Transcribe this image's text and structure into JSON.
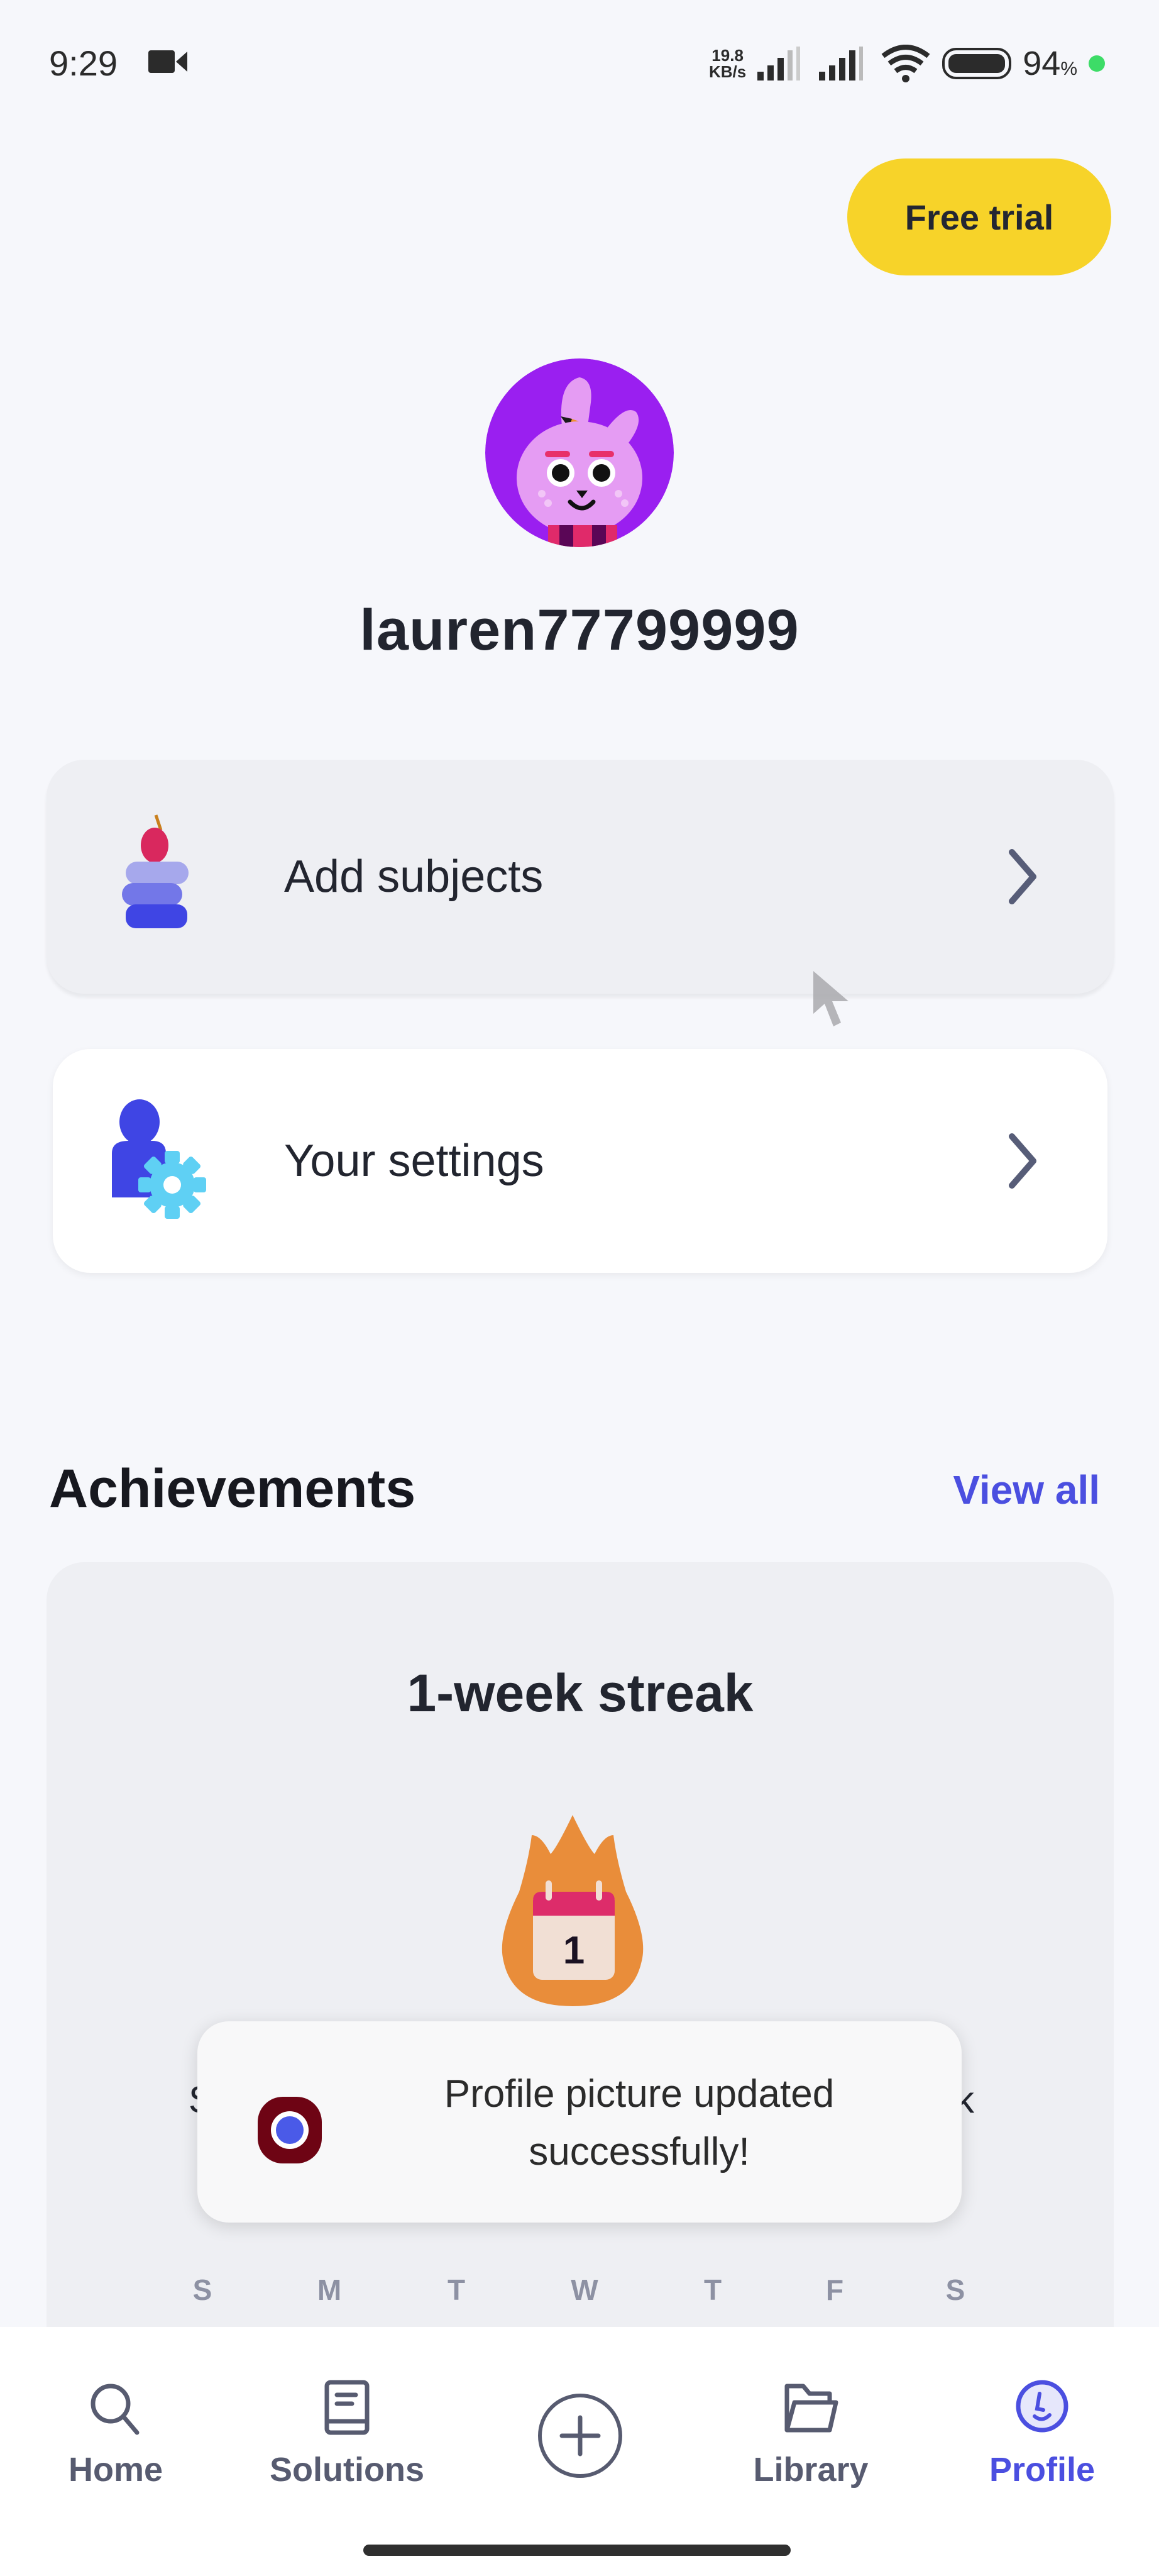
{
  "status_bar": {
    "time": "9:29",
    "network_speed_value": "19.8",
    "network_speed_unit": "KB/s",
    "battery_percent": "94",
    "battery_percent_sign": "%",
    "icons": [
      "video-camera-icon",
      "signal-icon",
      "signal-icon",
      "wifi-icon",
      "battery-icon",
      "charging-dot-icon"
    ]
  },
  "header": {
    "free_trial_label": "Free trial"
  },
  "profile": {
    "username": "lauren77799999",
    "avatar": "bunny-avatar"
  },
  "menu": [
    {
      "label": "Add subjects",
      "icon": "books-apple-icon"
    },
    {
      "label": "Your settings",
      "icon": "user-gear-icon"
    }
  ],
  "achievements": {
    "title": "Achievements",
    "view_all_label": "View all",
    "streak": {
      "title": "1-week streak",
      "calendar_number": "1",
      "hidden_text_left": "S",
      "hidden_text_right": "k",
      "weekdays": [
        "S",
        "M",
        "T",
        "W",
        "T",
        "F",
        "S"
      ]
    }
  },
  "toast": {
    "message": "Profile picture updated successfully!"
  },
  "bottom_nav": {
    "items": [
      {
        "label": "Home",
        "icon": "search-icon",
        "active": false
      },
      {
        "label": "Solutions",
        "icon": "book-icon",
        "active": false
      },
      {
        "label": "",
        "icon": "plus-circle-icon",
        "active": false
      },
      {
        "label": "Library",
        "icon": "folder-icon",
        "active": false
      },
      {
        "label": "Profile",
        "icon": "profile-icon",
        "active": true
      }
    ]
  },
  "colors": {
    "accent": "#4b4fe0",
    "free_trial_bg": "#f7d329",
    "background": "#f6f7fb",
    "card_gray": "#eeeff3",
    "flame": "#e98d3a"
  }
}
